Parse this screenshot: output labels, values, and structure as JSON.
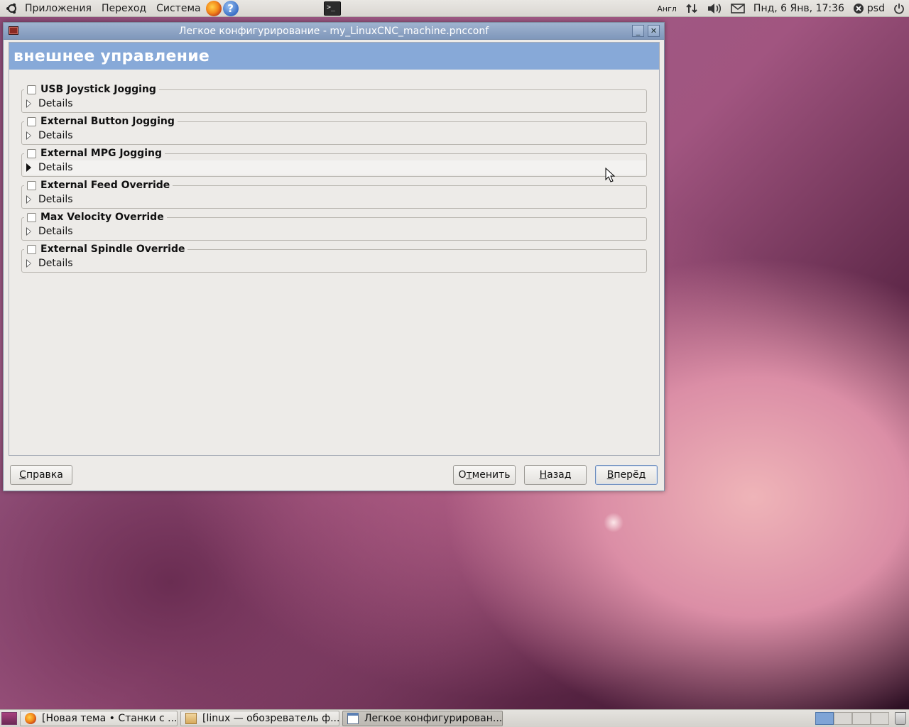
{
  "top_panel": {
    "menu_apps": "Приложения",
    "menu_places": "Переход",
    "menu_system": "Система",
    "help_glyph": "?",
    "terminal_glyph": ">_",
    "keyboard_layout": "Англ",
    "datetime": "Пнд, 6 Янв, 17:36",
    "user": "psd",
    "icons": [
      "ubuntu-logo-icon",
      "firefox-icon",
      "help-icon",
      "terminal-icon",
      "network-icon",
      "volume-icon",
      "mail-icon",
      "user-status-icon",
      "power-icon"
    ]
  },
  "window": {
    "title": "Легкое конфигурирование - my_LinuxCNC_machine.pncconf",
    "page_header": "внешнее управление",
    "minimize_glyph": "_",
    "close_glyph": "✕",
    "groups": [
      {
        "title": "USB Joystick Jogging",
        "checked": false,
        "details_label": "Details"
      },
      {
        "title": "External Button Jogging",
        "checked": false,
        "details_label": "Details"
      },
      {
        "title": "External MPG Jogging",
        "checked": false,
        "details_label": "Details"
      },
      {
        "title": "External Feed Override",
        "checked": false,
        "details_label": "Details"
      },
      {
        "title": "Max Velocity Override",
        "checked": false,
        "details_label": "Details"
      },
      {
        "title": "External Spindle Override",
        "checked": false,
        "details_label": "Details"
      }
    ],
    "buttons": {
      "help": {
        "mnemonic": "С",
        "rest": "правка"
      },
      "cancel": {
        "pre": "О",
        "mnemonic": "т",
        "rest": "менить"
      },
      "back": {
        "mnemonic": "Н",
        "rest": "азад"
      },
      "forward": {
        "mnemonic": "В",
        "rest": "перёд"
      }
    }
  },
  "taskbar": {
    "tasks": [
      {
        "label": "[Новая тема • Станки с ...",
        "icon": "firefox-icon"
      },
      {
        "label": "[linux — обозреватель ф...",
        "icon": "folder-icon"
      },
      {
        "label": "Легкое конфигурирован...",
        "icon": "window-icon",
        "active": true
      }
    ],
    "workspaces": 4,
    "active_workspace": 1
  },
  "colors": {
    "header_blue": "#87a9d8",
    "titlebar_blue": "#8fa5c6",
    "dialog_bg": "#edebe8"
  }
}
